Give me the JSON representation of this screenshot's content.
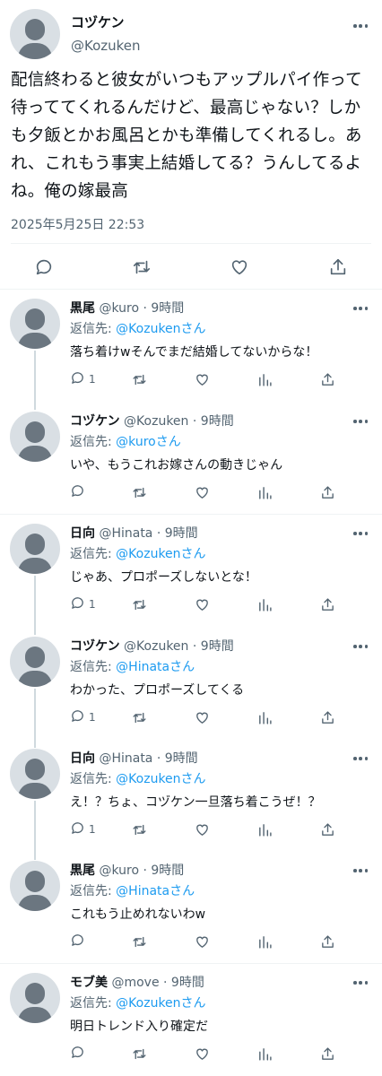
{
  "main": {
    "name": "コヅケン",
    "handle": "@Kozuken",
    "text": "配信終わると彼女がいつもアップルパイ作って待っててくれるんだけど、最高じゃない？しかも夕飯とかお風呂とかも準備してくれるし。あれ、これもう事実上結婚してる？うんしてるよね。俺の嫁最高",
    "timestamp": "2025年5月25日 22:53"
  },
  "replies": [
    {
      "name": "黒尾",
      "handle": "@kuro",
      "time": "9時間",
      "reply_prefix": "返信先: ",
      "reply_to": "@Kozukenさん",
      "text": "落ち着けwそんでまだ結婚してないからな！",
      "reply_count": "1"
    },
    {
      "name": "コヅケン",
      "handle": "@Kozuken",
      "time": "9時間",
      "reply_prefix": "返信先: ",
      "reply_to": "@kuroさん",
      "text": "いや、もうこれお嫁さんの動きじゃん",
      "reply_count": ""
    },
    {
      "name": "日向",
      "handle": "@Hinata",
      "time": "9時間",
      "reply_prefix": "返信先: ",
      "reply_to": "@Kozukenさん",
      "text": "じゃあ、プロポーズしないとな！",
      "reply_count": "1"
    },
    {
      "name": "コヅケン",
      "handle": "@Kozuken",
      "time": "9時間",
      "reply_prefix": "返信先: ",
      "reply_to": "@Hinataさん",
      "text": "わかった、プロポーズしてくる",
      "reply_count": "1"
    },
    {
      "name": "日向",
      "handle": "@Hinata",
      "time": "9時間",
      "reply_prefix": "返信先: ",
      "reply_to": "@Kozukenさん",
      "text": "え！？ちょ、コヅケン一旦落ち着こうぜ！？",
      "reply_count": "1"
    },
    {
      "name": "黒尾",
      "handle": "@kuro",
      "time": "9時間",
      "reply_prefix": "返信先: ",
      "reply_to": "@Hinataさん",
      "text": "これもう止めれないわw",
      "reply_count": ""
    },
    {
      "name": "モブ美",
      "handle": "@move",
      "time": "9時間",
      "reply_prefix": "返信先: ",
      "reply_to": "@Kozukenさん",
      "text": "明日トレンド入り確定だ",
      "reply_count": ""
    }
  ],
  "icons": {
    "reply": "comment-icon",
    "retweet": "retweet-icon",
    "like": "heart-icon",
    "views": "bar-chart-icon",
    "share": "share-icon",
    "more": "more-icon"
  },
  "colors": {
    "accent": "#1d9bf0",
    "secondary_text": "#536471",
    "divider": "#eff3f4",
    "thread_line": "#cfd9de"
  }
}
